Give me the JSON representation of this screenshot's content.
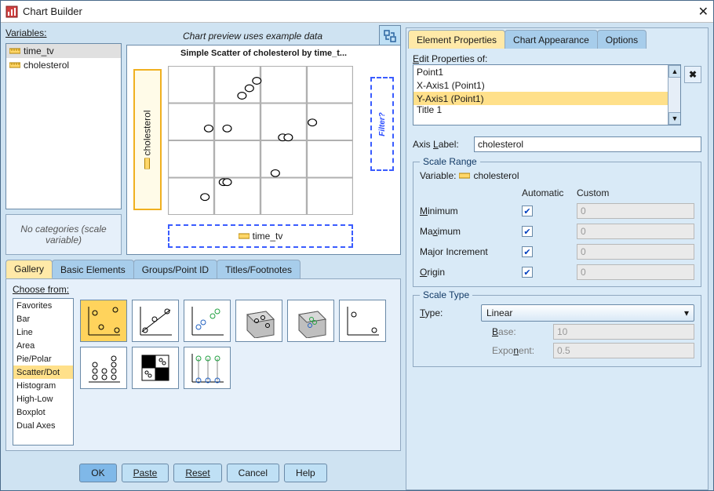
{
  "window": {
    "title": "Chart Builder"
  },
  "left": {
    "variables_label": "Variables:",
    "variables": [
      "time_tv",
      "cholesterol"
    ],
    "selected_variable": "time_tv",
    "no_categories_text": "No categories (scale variable)",
    "preview_caption": "Chart preview uses example data",
    "chart_title": "Simple Scatter of cholesterol by time_t...",
    "x_drop_label": "time_tv",
    "y_drop_label": "cholesterol",
    "filter_label": "Filter?"
  },
  "chart_data": {
    "type": "scatter",
    "xlabel": "time_tv",
    "ylabel": "cholesterol",
    "x": [
      0.2,
      0.3,
      0.32,
      0.58,
      0.22,
      0.32,
      0.4,
      0.44,
      0.62,
      0.65,
      0.48,
      0.78
    ],
    "y": [
      0.12,
      0.22,
      0.22,
      0.28,
      0.58,
      0.58,
      0.8,
      0.85,
      0.52,
      0.52,
      0.9,
      0.62
    ]
  },
  "lower_tabs": {
    "items": [
      "Gallery",
      "Basic Elements",
      "Groups/Point ID",
      "Titles/Footnotes"
    ],
    "active": "Gallery"
  },
  "gallery": {
    "choose_label": "Choose from:",
    "types": [
      "Favorites",
      "Bar",
      "Line",
      "Area",
      "Pie/Polar",
      "Scatter/Dot",
      "Histogram",
      "High-Low",
      "Boxplot",
      "Dual Axes"
    ],
    "selected_type": "Scatter/Dot",
    "thumbs": [
      "simple-scatter",
      "line-scatter",
      "grouped-scatter",
      "3d-scatter",
      "3d-grouped-scatter",
      "summary-point",
      "simple-dot",
      "scatter-matrix",
      "drop-line"
    ],
    "selected_thumb": "simple-scatter"
  },
  "dialog_buttons": {
    "ok": "OK",
    "paste": "Paste",
    "reset": "Reset",
    "cancel": "Cancel",
    "help": "Help"
  },
  "right_tabs": {
    "items": [
      "Element Properties",
      "Chart Appearance",
      "Options"
    ],
    "active": "Element Properties"
  },
  "right": {
    "edit_label": "Edit Properties of:",
    "edit_items": [
      "Point1",
      "X-Axis1 (Point1)",
      "Y-Axis1 (Point1)",
      "Title 1"
    ],
    "edit_selected": "Y-Axis1 (Point1)",
    "axis_label_lbl": "Axis Label:",
    "axis_label_value": "cholesterol",
    "scale_range_legend": "Scale Range",
    "variable_lbl": "Variable:",
    "variable_value": "cholesterol",
    "hdr_auto": "Automatic",
    "hdr_custom": "Custom",
    "range_rows": [
      {
        "label": "Minimum",
        "auto": true,
        "value": "0"
      },
      {
        "label": "Maximum",
        "auto": true,
        "value": "0"
      },
      {
        "label": "Major Increment",
        "auto": true,
        "value": "0"
      },
      {
        "label": "Origin",
        "auto": true,
        "value": "0"
      }
    ],
    "scale_type_legend": "Scale Type",
    "type_lbl": "Type:",
    "type_value": "Linear",
    "base_lbl": "Base:",
    "base_value": "10",
    "exponent_lbl": "Exponent:",
    "exponent_value": "0.5"
  }
}
